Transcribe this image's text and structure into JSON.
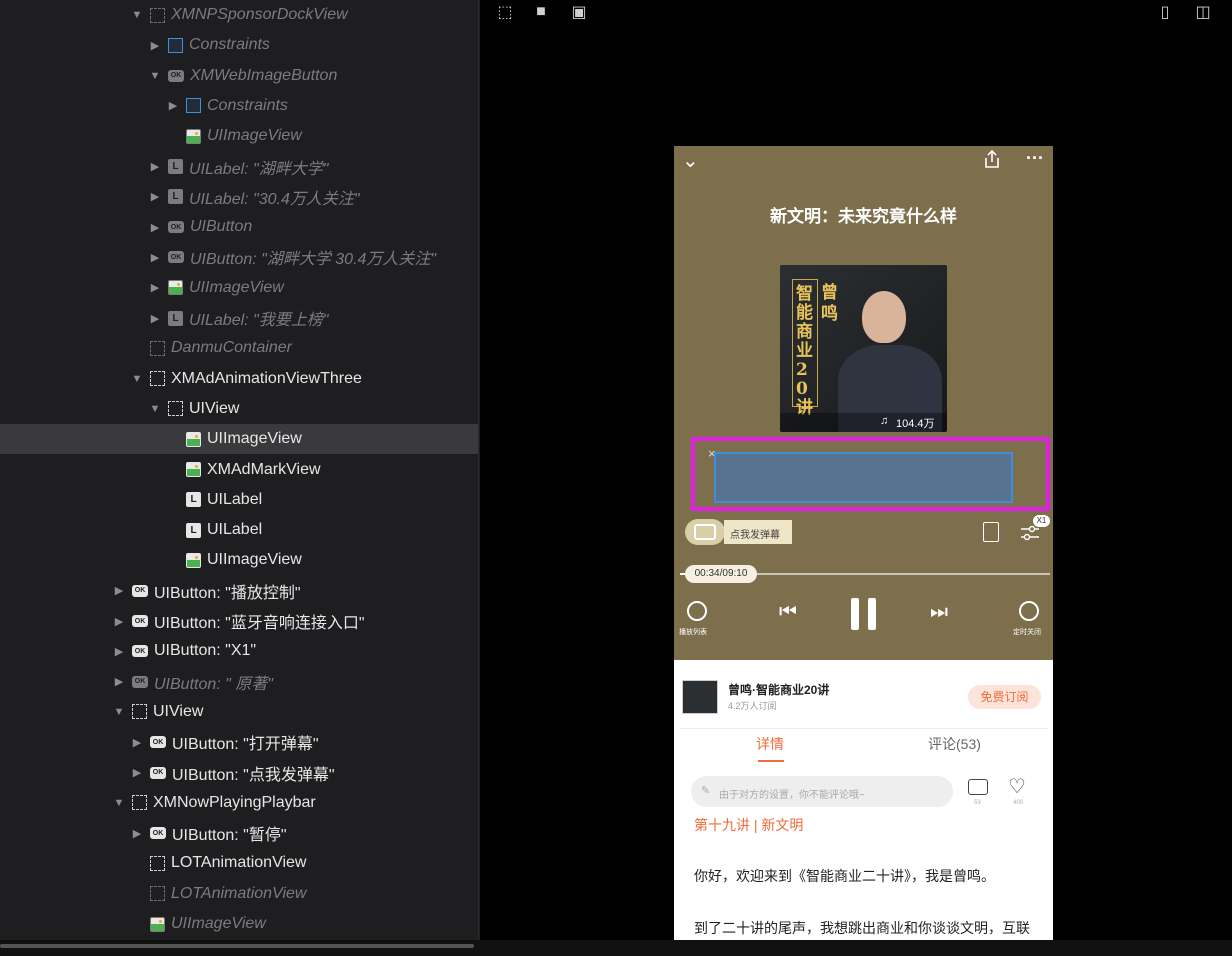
{
  "tree": {
    "rows": [
      {
        "label": "XMNPSponsorDockView",
        "icon": "view",
        "expand": "down",
        "indent": 0,
        "dim": true
      },
      {
        "label": "Constraints",
        "icon": "constraints",
        "expand": "right",
        "indent": 1,
        "dim": true
      },
      {
        "label": "XMWebImageButton",
        "icon": "button",
        "expand": "down",
        "indent": 1,
        "dim": true
      },
      {
        "label": "Constraints",
        "icon": "constraints",
        "expand": "right",
        "indent": 2,
        "dim": true
      },
      {
        "label": "UIImageView",
        "icon": "image",
        "expand": "none",
        "indent": 2,
        "dim": true
      },
      {
        "label": "UILabel: \"湖畔大学\"",
        "icon": "label",
        "expand": "right",
        "indent": 1,
        "dim": true
      },
      {
        "label": "UILabel: \"30.4万人关注\"",
        "icon": "label",
        "expand": "right",
        "indent": 1,
        "dim": true
      },
      {
        "label": "UIButton",
        "icon": "button",
        "expand": "right",
        "indent": 1,
        "dim": true
      },
      {
        "label": "UIButton: \"湖畔大学 30.4万人关注\"",
        "icon": "button",
        "expand": "right",
        "indent": 1,
        "dim": true
      },
      {
        "label": "UIImageView",
        "icon": "image",
        "expand": "right",
        "indent": 1,
        "dim": true
      },
      {
        "label": "UILabel: \"我要上榜\"",
        "icon": "label",
        "expand": "right",
        "indent": 1,
        "dim": true
      },
      {
        "label": "DanmuContainer",
        "icon": "view",
        "expand": "none",
        "indent": 0,
        "dim": true
      },
      {
        "label": "XMAdAnimationViewThree",
        "icon": "view",
        "expand": "down",
        "indent": 0,
        "dim": false
      },
      {
        "label": "UIView",
        "icon": "view",
        "expand": "down",
        "indent": 1,
        "dim": false
      },
      {
        "label": "UIImageView",
        "icon": "image",
        "expand": "none",
        "indent": 2,
        "dim": false,
        "selected": true
      },
      {
        "label": "XMAdMarkView",
        "icon": "image",
        "expand": "none",
        "indent": 2,
        "dim": false
      },
      {
        "label": "UILabel",
        "icon": "label",
        "expand": "none",
        "indent": 2,
        "dim": false
      },
      {
        "label": "UILabel",
        "icon": "label",
        "expand": "none",
        "indent": 2,
        "dim": false
      },
      {
        "label": "UIImageView",
        "icon": "image",
        "expand": "none",
        "indent": 2,
        "dim": false
      },
      {
        "label": "UIButton: \"播放控制\"",
        "icon": "button",
        "expand": "right",
        "indent": -1,
        "dim": false
      },
      {
        "label": "UIButton: \"蓝牙音响连接入口\"",
        "icon": "button",
        "expand": "right",
        "indent": -1,
        "dim": false
      },
      {
        "label": "UIButton: \"X1\"",
        "icon": "button",
        "expand": "right",
        "indent": -1,
        "dim": false
      },
      {
        "label": "UIButton: \" 原著\"",
        "icon": "button",
        "expand": "right",
        "indent": -1,
        "dim": true
      },
      {
        "label": "UIView",
        "icon": "view",
        "expand": "down",
        "indent": -1,
        "dim": false
      },
      {
        "label": "UIButton: \"打开弹幕\"",
        "icon": "button",
        "expand": "right",
        "indent": 0,
        "dim": false
      },
      {
        "label": "UIButton: \"点我发弹幕\"",
        "icon": "button",
        "expand": "right",
        "indent": 0,
        "dim": false
      },
      {
        "label": "XMNowPlayingPlaybar",
        "icon": "view",
        "expand": "down",
        "indent": -1,
        "dim": false
      },
      {
        "label": "UIButton: \"暂停\"",
        "icon": "button",
        "expand": "right",
        "indent": 0,
        "dim": false
      },
      {
        "label": "LOTAnimationView",
        "icon": "view",
        "expand": "none",
        "indent": 0,
        "dim": false
      },
      {
        "label": "LOTAnimationView",
        "icon": "view",
        "expand": "none",
        "indent": 0,
        "dim": true
      },
      {
        "label": "UIImageView",
        "icon": "image",
        "expand": "none",
        "indent": 0,
        "dim": true
      }
    ]
  },
  "phone": {
    "title": "新文明：未来究竟什么样",
    "cover_title": "智能商业20讲",
    "cover_author": "曾鸣",
    "play_count": "104.4万",
    "danmu_placeholder": "点我发弹幕",
    "speed_badge": "X1",
    "time": "00:34/09:10",
    "progress": 0.06,
    "left_ctrl_label": "播放列表",
    "right_ctrl_label": "定时关闭",
    "album_name": "曾鸣·智能商业20讲",
    "album_subs": "4.2万人订阅",
    "subscribe": "免费订阅",
    "tab_detail": "详情",
    "tab_comments": "评论(53)",
    "comment_placeholder": "由于对方的设置，你不能评论哦~",
    "comment_count": "53",
    "like_count": "400",
    "episode": "第十九讲 | 新文明",
    "para1": "你好，欢迎来到《智能商业二十讲》，我是曾鸣。",
    "para2": "到了二十讲的尾声，我想跳出商业和你谈谈文明，互联"
  },
  "colors": {
    "panel_bg": "#1e1e20",
    "selected_row": "#3a3a3d",
    "player_bg": "#7d6e4c",
    "accent_orange": "#f26b3a",
    "ad_highlight": "#e020e0",
    "ad_selection": "#3d8de0"
  }
}
